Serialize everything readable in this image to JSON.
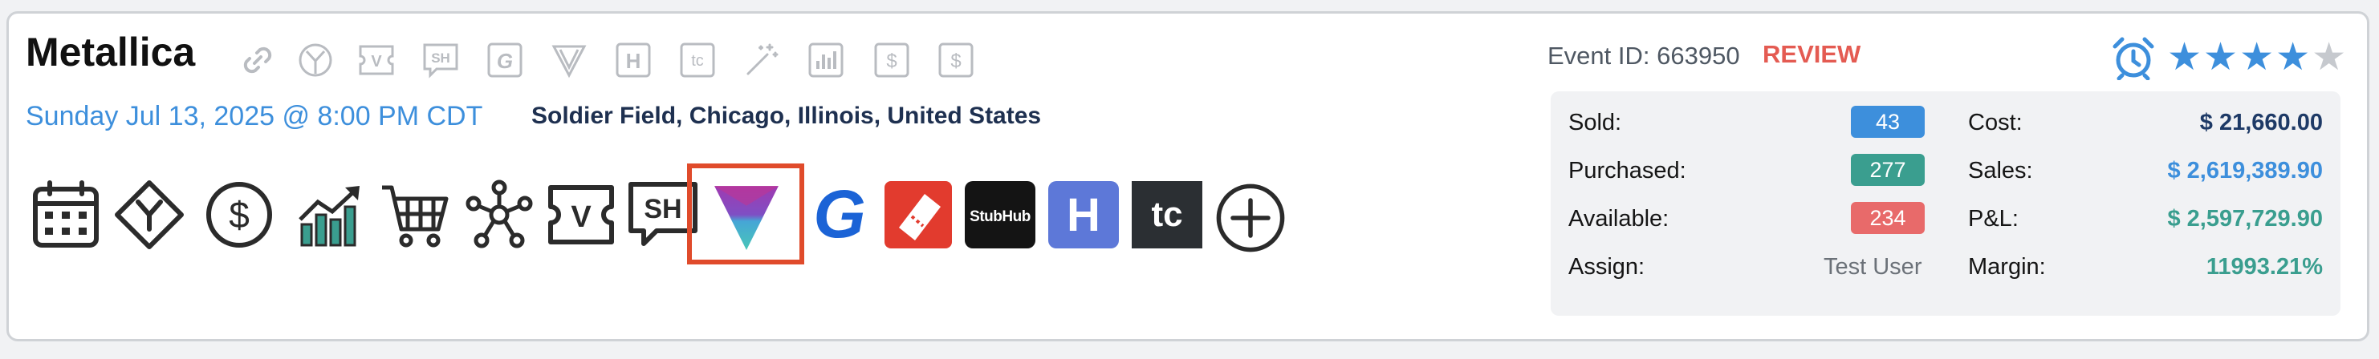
{
  "event": {
    "title": "Metallica",
    "date": "Sunday Jul 13, 2025 @ 8:00 PM CDT",
    "venue": "Soldier Field, Chicago, Illinois, United States",
    "event_id_label": "Event ID:",
    "event_id": "663950",
    "status": "REVIEW",
    "rating": 4,
    "rating_max": 5
  },
  "top_icons": [
    "link-icon",
    "split-icon",
    "vivid-seats-icon",
    "stubhub-sh-icon",
    "gametime-icon",
    "vividseats-v-icon",
    "hotel-h-icon",
    "tc-icon",
    "magic-wand-icon",
    "chart-icon",
    "dollar-icon",
    "dollar-icon"
  ],
  "top_icon_text": {
    "vs": "V",
    "sh": "SH",
    "g": "G",
    "h": "H",
    "tc": "tc",
    "dollar": "$"
  },
  "action_icons": {
    "v": "V",
    "sh": "SH",
    "stubhub": "StubHub",
    "h": "H",
    "tc": "tc",
    "dollar": "$",
    "g": "G"
  },
  "colors": {
    "accent": "#3d8fdc",
    "review": "#e45b52",
    "sold_badge": "#3d8fdc",
    "purchased_badge": "#3a9e8f",
    "available_badge": "#e86a6a",
    "cost": "#1e3a66",
    "sales": "#3d8fdc",
    "pnl": "#3a9e8f",
    "margin": "#3a9e8f",
    "highlight": "#e04b2b"
  },
  "stats": {
    "sold_label": "Sold:",
    "sold": "43",
    "purchased_label": "Purchased:",
    "purchased": "277",
    "available_label": "Available:",
    "available": "234",
    "assign_label": "Assign:",
    "assign": "Test User",
    "cost_label": "Cost:",
    "cost": "$ 21,660.00",
    "sales_label": "Sales:",
    "sales": "$ 2,619,389.90",
    "pnl_label": "P&L:",
    "pnl": "$ 2,597,729.90",
    "margin_label": "Margin:",
    "margin": "11993.21%"
  }
}
